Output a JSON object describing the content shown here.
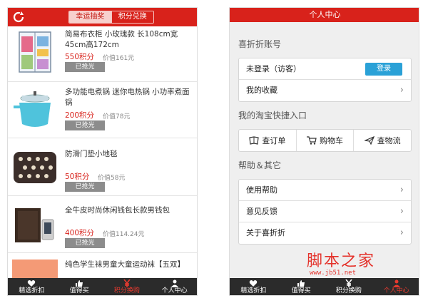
{
  "left": {
    "tabs": [
      {
        "label": "幸运抽奖",
        "active": true
      },
      {
        "label": "积分兑换",
        "active": false
      }
    ],
    "items": [
      {
        "title": "简易布衣柜 小玫瑰款 长108cm宽45cm高172cm",
        "points": "550积分",
        "value": "价值161元",
        "status": "已抢光"
      },
      {
        "title": "多功能电煮锅 迷你电热锅 小功率煮面锅",
        "points": "200积分",
        "value": "价值78元",
        "status": "已抢光"
      },
      {
        "title": "防滑门垫小地毯",
        "points": "50积分",
        "value": "价值58元",
        "status": "已抢光"
      },
      {
        "title": "全牛皮时尚休闲钱包长款男钱包",
        "points": "400积分",
        "value": "价值114.24元",
        "status": "已抢光"
      },
      {
        "title": "纯色学生袜男童大童运动袜【五双】",
        "points": "",
        "value": "",
        "status": ""
      }
    ],
    "tabbar": [
      {
        "label": "精选折扣",
        "icon": "heart-icon",
        "active": false
      },
      {
        "label": "值得买",
        "icon": "thumbs-up-icon",
        "active": false
      },
      {
        "label": "积分换购",
        "icon": "yen-icon",
        "active": true
      },
      {
        "label": "个人中心",
        "icon": "person-icon",
        "active": false
      }
    ]
  },
  "right": {
    "title": "个人中心",
    "sections": {
      "account": "喜折折账号",
      "taobao": "我的淘宝快捷入口",
      "help": "帮助＆其它"
    },
    "account_rows": {
      "login_status": "未登录（访客）",
      "login_button": "登录",
      "favorites": "我的收藏"
    },
    "quick": [
      {
        "label": "查订单",
        "icon": "order-book-icon"
      },
      {
        "label": "购物车",
        "icon": "cart-icon"
      },
      {
        "label": "查物流",
        "icon": "paper-plane-icon"
      }
    ],
    "help_rows": [
      "使用帮助",
      "意见反馈",
      "关于喜折折"
    ],
    "tabbar": [
      {
        "label": "精选折扣",
        "icon": "heart-icon",
        "active": false
      },
      {
        "label": "值得买",
        "icon": "thumbs-up-icon",
        "active": false
      },
      {
        "label": "积分换购",
        "icon": "yen-icon",
        "active": false
      },
      {
        "label": "个人中心",
        "icon": "person-icon",
        "active": true
      }
    ]
  },
  "watermark": {
    "title": "脚本之家",
    "url": "www.jb51.net"
  },
  "colors": {
    "brand_red": "#d8221b",
    "tabbar_bg": "#2b2b2b",
    "login_blue": "#2aa1d7",
    "sold_gray": "#8c8c8c"
  }
}
